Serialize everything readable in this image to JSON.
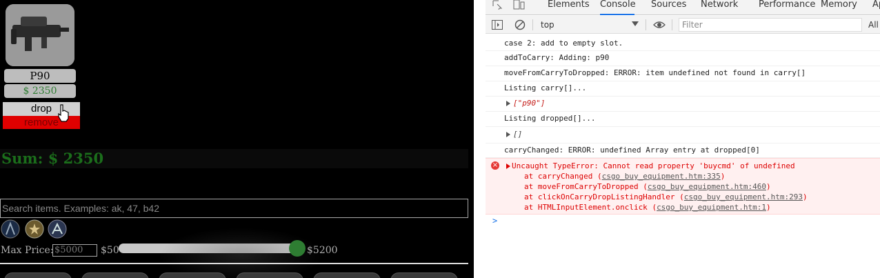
{
  "item": {
    "name": "P90",
    "price": "$ 2350",
    "drop_label": "drop",
    "remove_label": "remove"
  },
  "sum": {
    "text": "Sum: $ 2350"
  },
  "search": {
    "placeholder": "Search items. Examples: ak, 47, b42"
  },
  "price_filter": {
    "label": "Max Price:",
    "value": "$5000",
    "min_label": "$50",
    "max_label": "$5200"
  },
  "devtools": {
    "tabs": [
      "Elements",
      "Console",
      "Sources",
      "Network",
      "Performance",
      "Memory",
      "Ap"
    ],
    "active_tab": "Console",
    "context": "top",
    "filter_placeholder": "Filter",
    "levels_label": "All",
    "console_lines": [
      "case 2: add to empty slot.",
      "addToCarry: Adding: p90",
      "moveFromCarryToDropped: ERROR: item undefined not found in carry[]",
      "Listing carry[]...",
      "[\"p90\"]",
      "Listing dropped[]...",
      "[]",
      "carryChanged: ERROR: undefined Array entry at dropped[0]"
    ],
    "error": {
      "message": "Uncaught TypeError: Cannot read property 'buycmd' of undefined",
      "stack": [
        {
          "at": "at carryChanged ",
          "link": "csgo_buy_equipment.htm:335"
        },
        {
          "at": "at moveFromCarryToDropped ",
          "link": "csgo_buy_equipment.htm:460"
        },
        {
          "at": "at clickOnCarryDropListingHandler ",
          "link": "csgo_buy_equipment.htm:293"
        },
        {
          "at": "at HTMLInputElement.onclick ",
          "link": "csgo_buy_equipment.htm:1"
        }
      ]
    },
    "prompt": ">"
  },
  "colors": {
    "accent": "#1a73e8",
    "error": "#dd0000",
    "price_green": "#2e7d32",
    "remove_red": "#e00000"
  }
}
